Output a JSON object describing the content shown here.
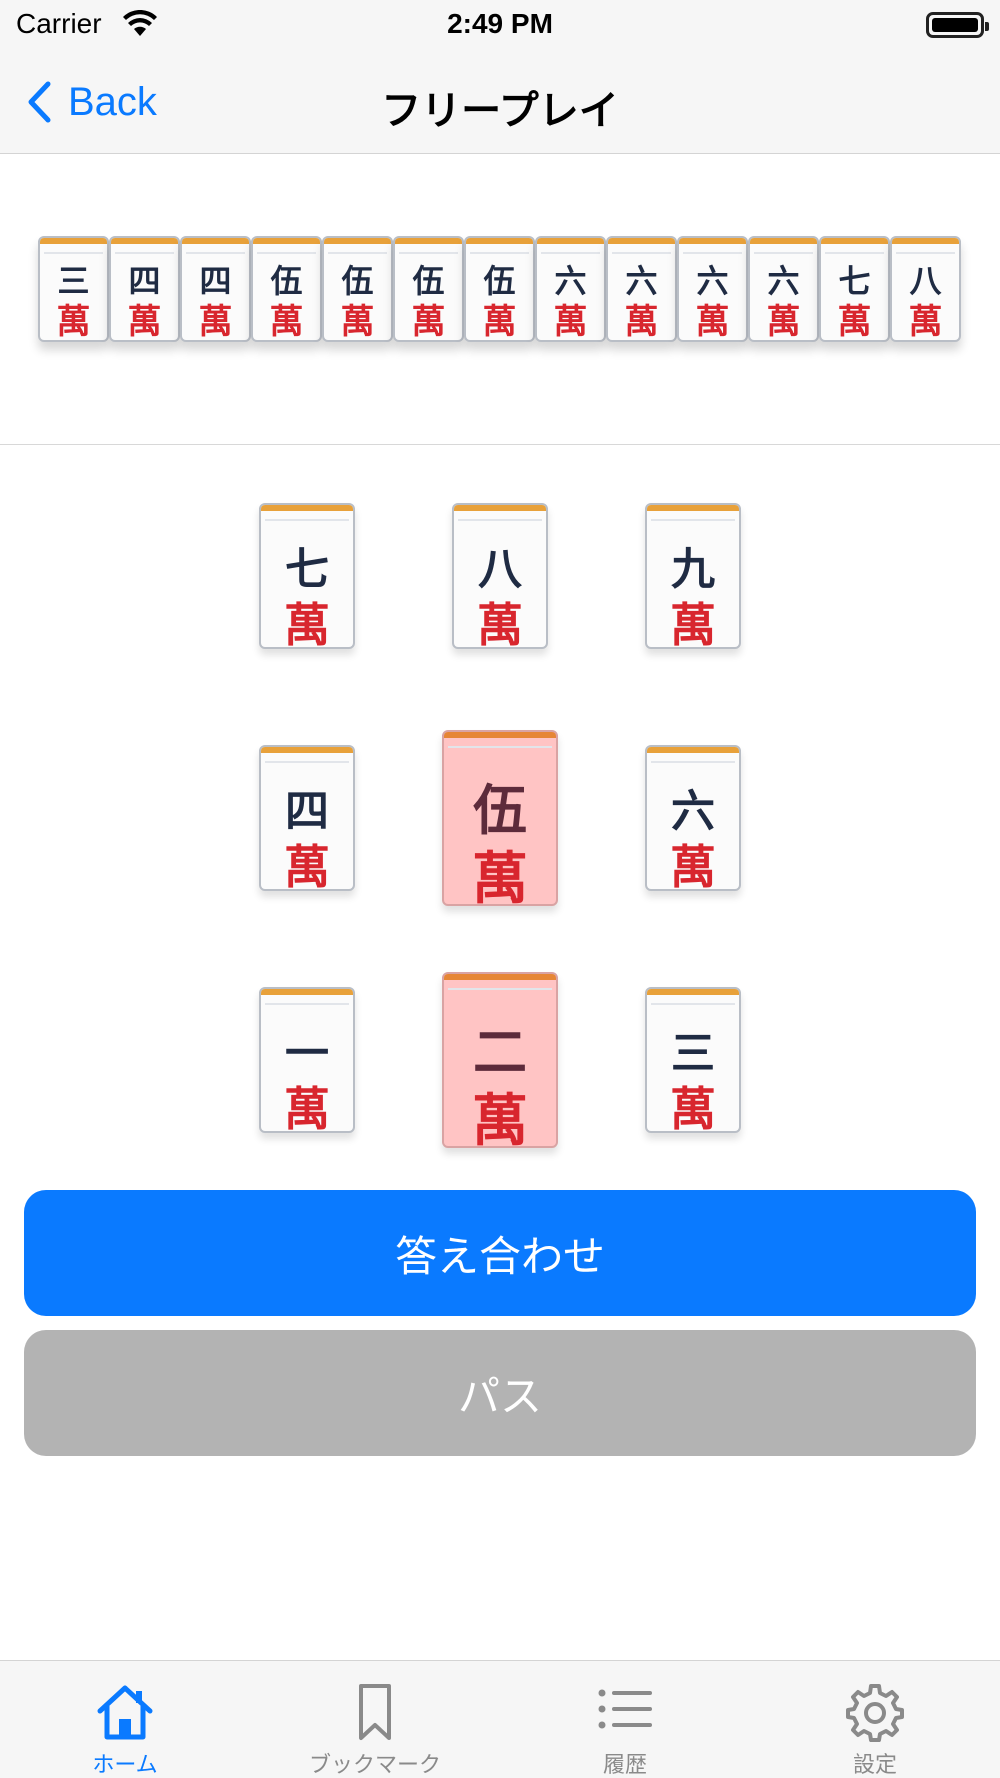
{
  "status_bar": {
    "carrier": "Carrier",
    "time": "2:49 PM"
  },
  "nav": {
    "back_label": "Back",
    "title": "フリープレイ"
  },
  "hand": [
    {
      "num": "三",
      "suit": "萬"
    },
    {
      "num": "四",
      "suit": "萬"
    },
    {
      "num": "四",
      "suit": "萬"
    },
    {
      "num": "伍",
      "suit": "萬"
    },
    {
      "num": "伍",
      "suit": "萬"
    },
    {
      "num": "伍",
      "suit": "萬"
    },
    {
      "num": "伍",
      "suit": "萬"
    },
    {
      "num": "六",
      "suit": "萬"
    },
    {
      "num": "六",
      "suit": "萬"
    },
    {
      "num": "六",
      "suit": "萬"
    },
    {
      "num": "六",
      "suit": "萬"
    },
    {
      "num": "七",
      "suit": "萬"
    },
    {
      "num": "八",
      "suit": "萬"
    }
  ],
  "choices": [
    {
      "num": "七",
      "suit": "萬",
      "selected": false
    },
    {
      "num": "八",
      "suit": "萬",
      "selected": false
    },
    {
      "num": "九",
      "suit": "萬",
      "selected": false
    },
    {
      "num": "四",
      "suit": "萬",
      "selected": false
    },
    {
      "num": "伍",
      "suit": "萬",
      "selected": true
    },
    {
      "num": "六",
      "suit": "萬",
      "selected": false
    },
    {
      "num": "一",
      "suit": "萬",
      "selected": false
    },
    {
      "num": "二",
      "suit": "萬",
      "selected": true
    },
    {
      "num": "三",
      "suit": "萬",
      "selected": false
    }
  ],
  "buttons": {
    "check": "答え合わせ",
    "pass": "パス"
  },
  "tabs": [
    {
      "label": "ホーム",
      "icon": "home-icon",
      "active": true
    },
    {
      "label": "ブックマーク",
      "icon": "bookmark-icon",
      "active": false
    },
    {
      "label": "履歴",
      "icon": "list-icon",
      "active": false
    },
    {
      "label": "設定",
      "icon": "gear-icon",
      "active": false
    }
  ],
  "colors": {
    "accent": "#0a7aff",
    "pass": "#b3b3b3",
    "selected_tile": "#ffc4c4",
    "suit_red": "#d8262e"
  }
}
